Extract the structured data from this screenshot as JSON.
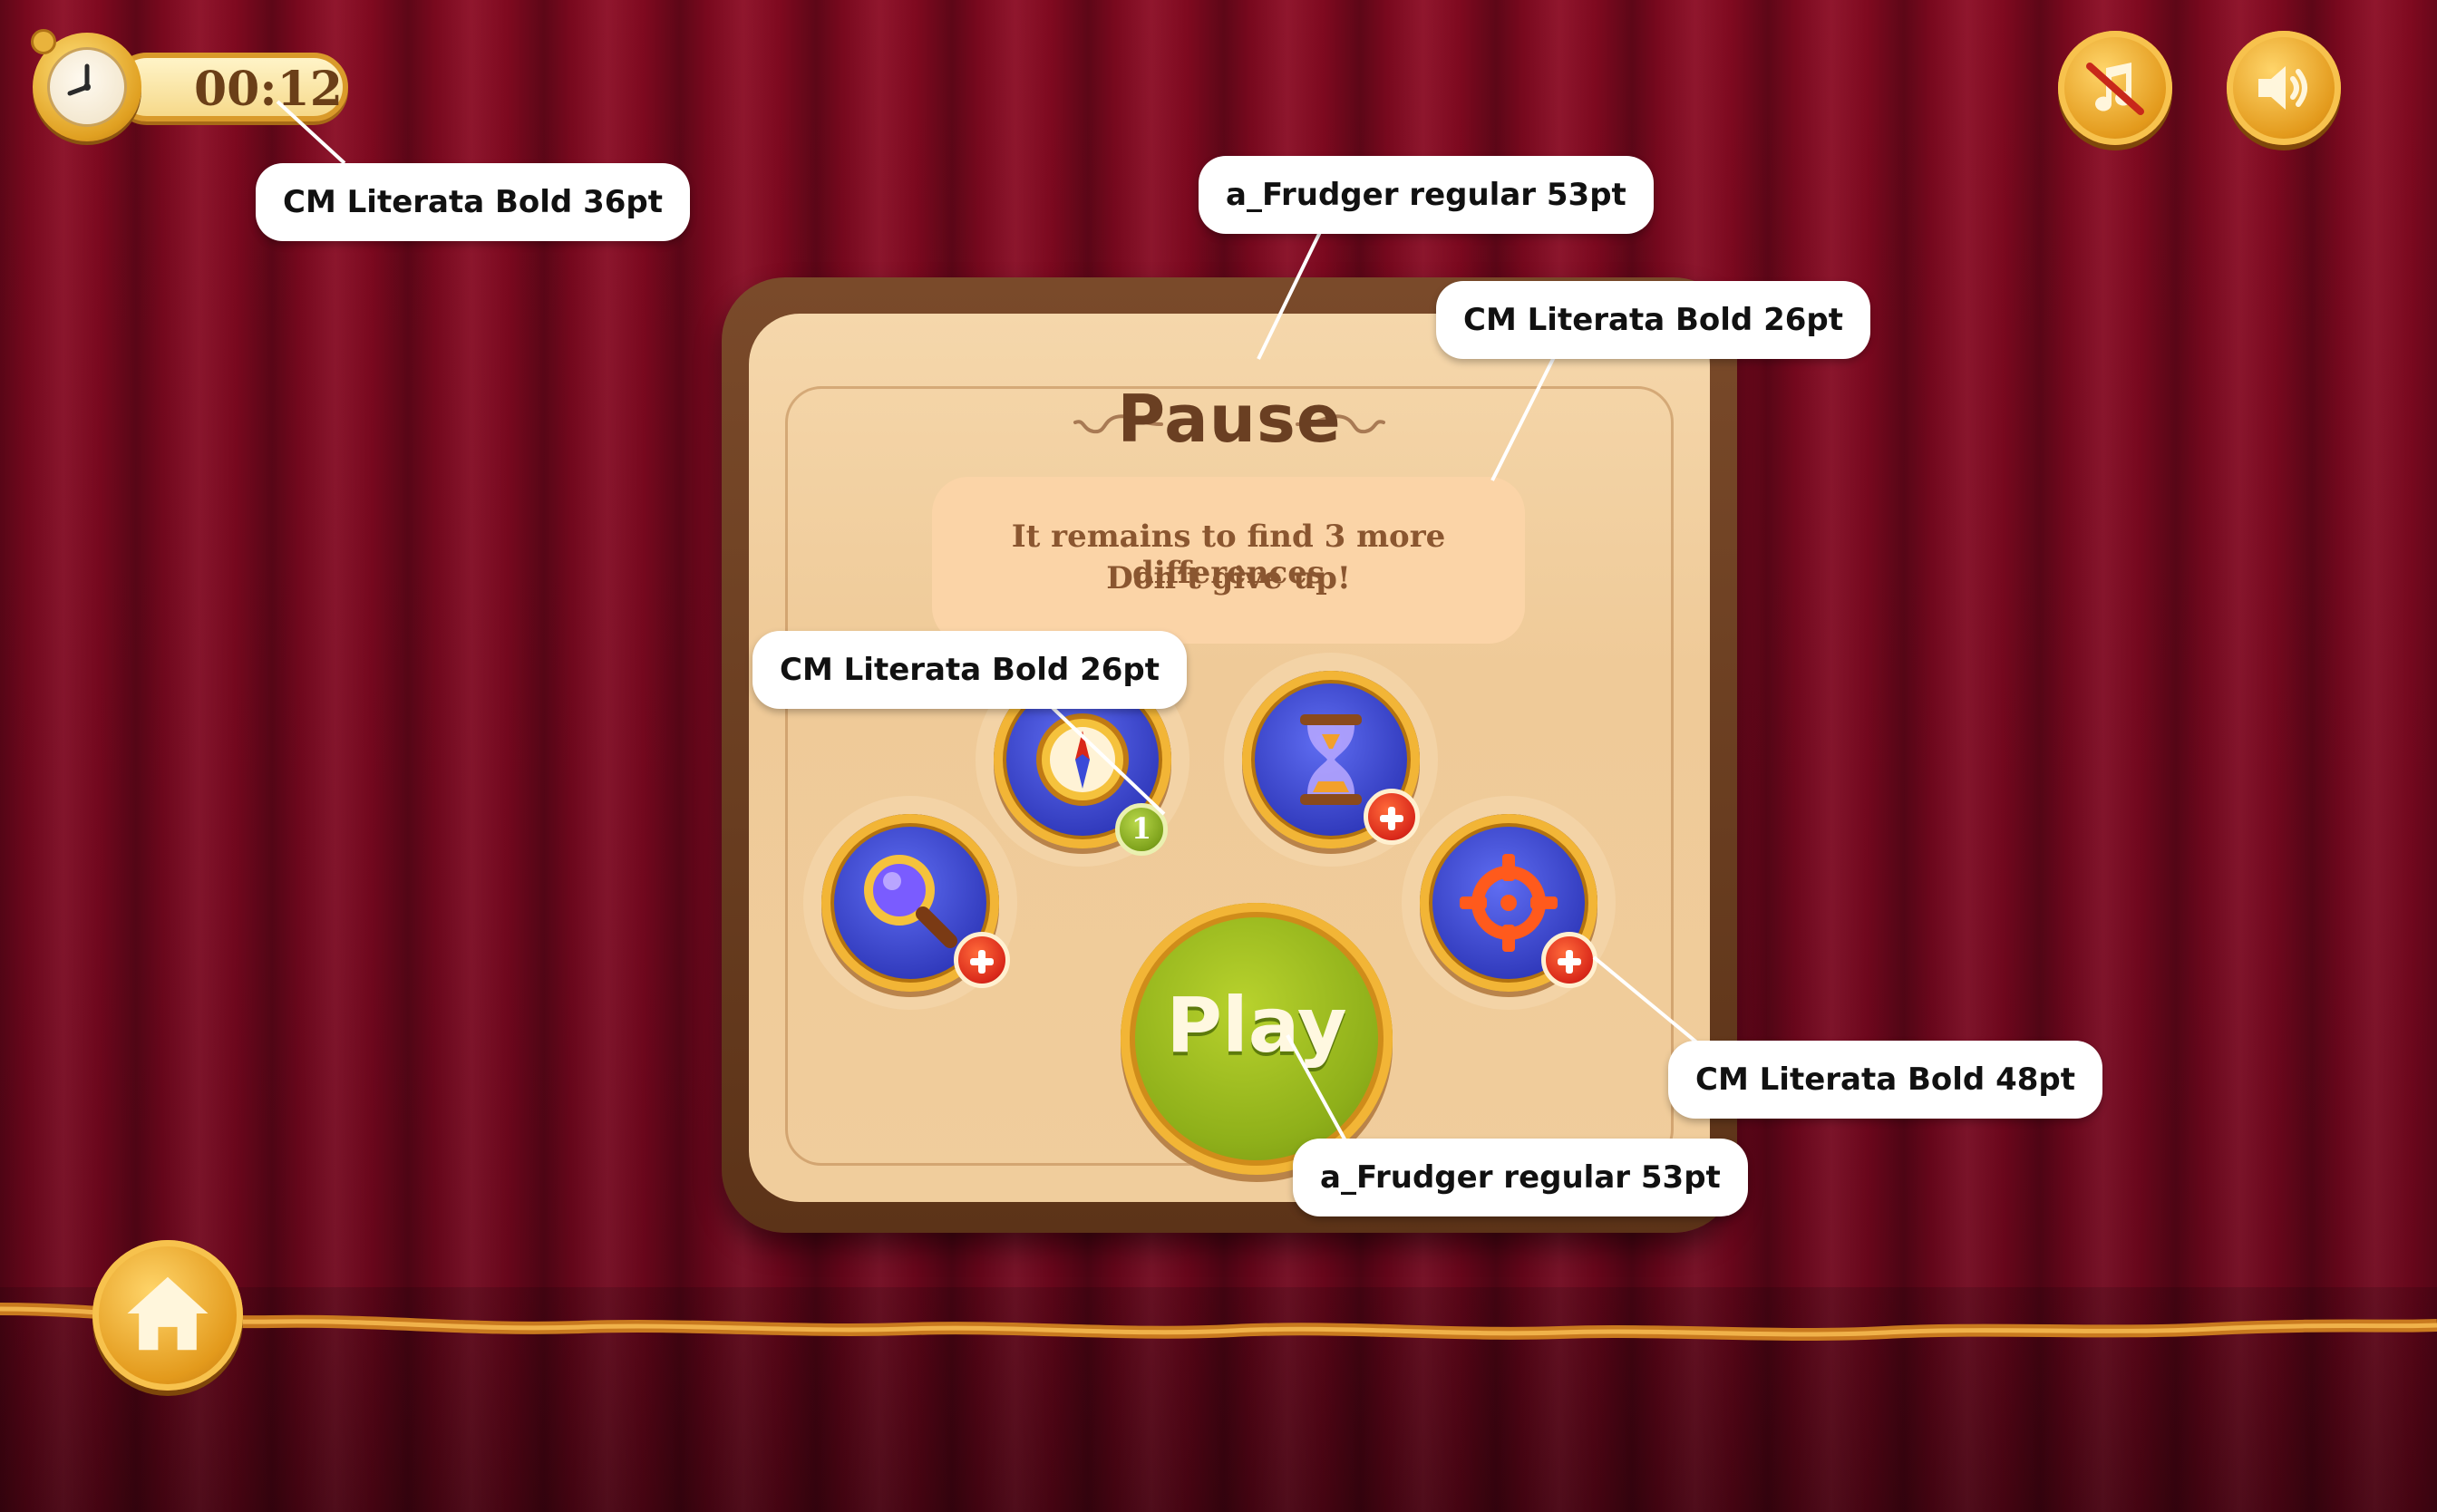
{
  "timer": {
    "value": "00:12",
    "font_note": "CM Literata Bold 36pt"
  },
  "top_controls": {
    "music_icon": "music-off-icon",
    "sound_icon": "speaker-icon"
  },
  "home": {
    "icon": "home-icon"
  },
  "pause_panel": {
    "title": "Pause",
    "title_font_note": "a_Frudger regular 53pt",
    "message": {
      "line1": "It remains to find 3 more differences",
      "line2": "Don’t give up!",
      "font_note": "CM Literata Bold 26pt"
    },
    "boosters": [
      {
        "icon": "magnifier-icon",
        "badge": "plus"
      },
      {
        "icon": "compass-icon",
        "badge": "count",
        "count": "1",
        "font_note": "CM Literata Bold 26pt"
      },
      {
        "icon": "hourglass-icon",
        "badge": "plus"
      },
      {
        "icon": "crosshair-icon",
        "badge": "plus",
        "font_note": "CM Literata Bold 48pt"
      }
    ],
    "play": {
      "label": "Play",
      "font_note": "a_Frudger regular 53pt"
    }
  },
  "colors": {
    "curtain": "#7a0820",
    "gold": "#e39a1c",
    "panel_frame": "#6a3d20",
    "paper": "#f2cf9f",
    "booster_blue": "#3440c8",
    "play_green": "#8fb01a",
    "badge_red": "#d9281a"
  }
}
